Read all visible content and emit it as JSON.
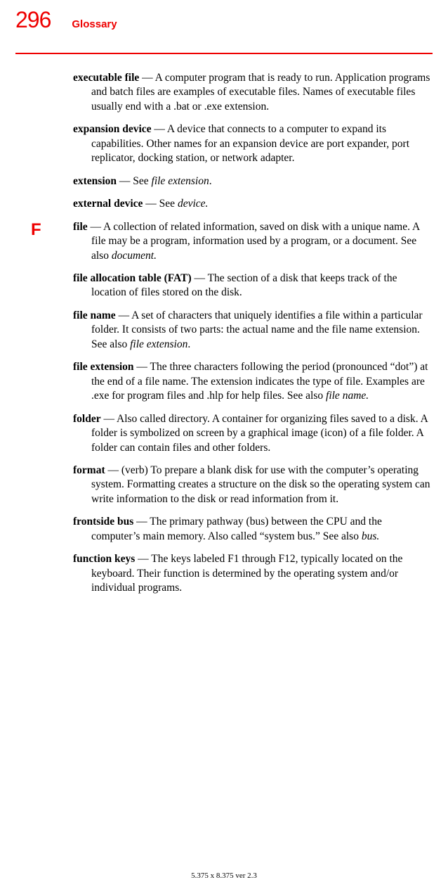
{
  "header": {
    "page_number": "296",
    "section_title": "Glossary"
  },
  "letter_marker": "F",
  "entries": {
    "executable_file": {
      "term": "executable file",
      "def": " — A computer program that is ready to run. Application programs and batch files are examples of executable files. Names of executable files usually end with a .bat or .exe extension."
    },
    "expansion_device": {
      "term": "expansion device",
      "def": " — A device that connects to a computer to expand its capabilities. Other names for an expansion device are port expander, port replicator, docking station, or network adapter."
    },
    "extension": {
      "term": "extension",
      "def_pre": " — See ",
      "def_it": "file extension",
      "def_post": "."
    },
    "external_device": {
      "term": "external device",
      "def_pre": " — See ",
      "def_it": "device.",
      "def_post": ""
    },
    "file": {
      "term": "file",
      "def_pre": " — A collection of related information, saved on disk with a unique name. A file may be a program, information used by a program, or a document. See also ",
      "def_it": "document.",
      "def_post": ""
    },
    "fat": {
      "term": "file allocation table (FAT)",
      "def": " — The section of a disk that keeps track of the location of files stored on the disk."
    },
    "file_name": {
      "term": "file name",
      "def_pre": " — A set of characters that uniquely identifies a file within a particular folder. It consists of two parts: the actual name and the file name extension. See also ",
      "def_it": "file extension",
      "def_post": "."
    },
    "file_extension": {
      "term": "file extension",
      "def_pre": " — The three characters following the period (pronounced “dot”) at the end of a file name. The extension indicates the type of file. Examples are .exe for program files and .hlp for help files. See also ",
      "def_it": "file name.",
      "def_post": ""
    },
    "folder": {
      "term": "folder",
      "def": " — Also called directory. A container for organizing files saved to a disk. A folder is symbolized on screen by a graphical image (icon) of a file folder. A folder can contain files and other folders."
    },
    "format": {
      "term": "format",
      "def": " — (verb) To prepare a blank disk for use with the computer’s operating system. Formatting creates a structure on the disk so the operating system can write information to the disk or read information from it."
    },
    "frontside_bus": {
      "term": "frontside bus",
      "def_pre": " — The primary pathway (bus) between the CPU and the computer’s main memory. Also called “system bus.” See also ",
      "def_it": "bus.",
      "def_post": ""
    },
    "function_keys": {
      "term": "function keys",
      "def": " — The keys labeled F1 through F12, typically located on the keyboard. Their function is determined by the operating system and/or individual programs."
    }
  },
  "footer": "5.375 x 8.375 ver 2.3"
}
